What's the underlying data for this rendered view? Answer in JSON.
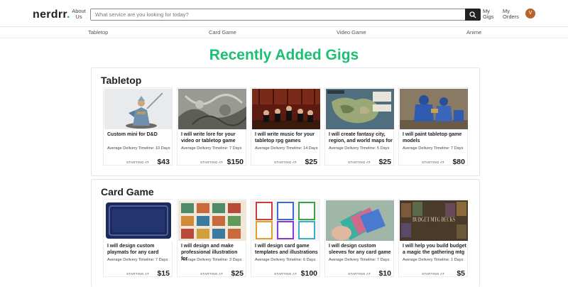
{
  "header": {
    "logo": "nerdrr",
    "logo_dot": ".",
    "about_label": "About Us",
    "search_placeholder": "What service are you looking for today?",
    "my_gigs_label": "My Gigs",
    "my_orders_label": "My Orders",
    "avatar_initial": "V"
  },
  "nav": {
    "items": [
      {
        "label": "Tabletop"
      },
      {
        "label": "Card Game"
      },
      {
        "label": "Video Game"
      },
      {
        "label": "Anime"
      }
    ]
  },
  "page_title": "Recently Added Gigs",
  "sections": [
    {
      "title": "Tabletop",
      "cards": [
        {
          "title": "Custom mini for D&D",
          "delivery": "Average Delivery Timeline: 10 Days",
          "starting": "STARTING AT",
          "price": "$43"
        },
        {
          "title": "I will write lore for your video or tabletop game",
          "delivery": "Average Delivery Timeline: 7 Days",
          "starting": "STARTING AT",
          "price": "$150"
        },
        {
          "title": "I will write music for your tabletop rpg games",
          "delivery": "Average Delivery Timeline: 14 Days",
          "starting": "STARTING AT",
          "price": "$25"
        },
        {
          "title": "I will create fantasy city, region, and world maps for",
          "delivery": "Average Delivery Timeline: 5 Days",
          "starting": "STARTING AT",
          "price": "$25"
        },
        {
          "title": "I will paint tabletop game models",
          "delivery": "Average Delivery Timeline: 7 Days",
          "starting": "STARTING AT",
          "price": "$80"
        }
      ]
    },
    {
      "title": "Card Game",
      "cards": [
        {
          "title": "I will design custom playmats for any card",
          "delivery": "Average Delivery Timeline: 7 Days",
          "starting": "STARTING AT",
          "price": "$15"
        },
        {
          "title": "I will design and make professional illustration for",
          "delivery": "Average Delivery Timeline: 3 Days",
          "starting": "STARTING AT",
          "price": "$25"
        },
        {
          "title": "I will design card game templates and illustrations",
          "delivery": "Average Delivery Timeline: 6 Days",
          "starting": "STARTING AT",
          "price": "$100"
        },
        {
          "title": "I will design custom sleeves for any card game",
          "delivery": "Average Delivery Timeline: 7 Days",
          "starting": "STARTING AT",
          "price": "$10"
        },
        {
          "title": "I will help you build budget a magic the gathering mtg",
          "delivery": "Average Delivery Timeline: 1 Days",
          "starting": "STARTING AT",
          "price": "$5",
          "image_text": "BUDGET MTG DECKS"
        }
      ]
    }
  ],
  "colors": {
    "brand": "#1dbf73",
    "avatar": "#b8642a",
    "search_button": "#222222"
  }
}
